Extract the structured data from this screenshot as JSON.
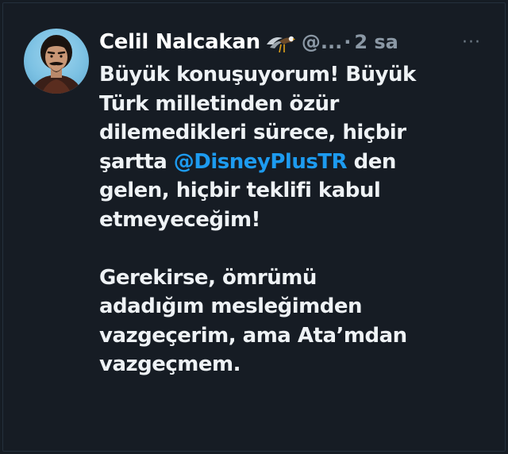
{
  "tweet": {
    "author_name": "Celil Nalcakan",
    "handle": "@...",
    "separator": "·",
    "time": "2 sa",
    "more_label": "···",
    "badge_icon": "eagle-emoji",
    "paragraph1": {
      "line1": "Büyük konuşuyorum! Büyük",
      "line2": "Türk milletinden özür",
      "line3": "dilemedikleri sürece, hiçbir",
      "line4_before": "şartta ",
      "mention": "@DisneyPlusTR",
      "line4_after": " den",
      "line5": "gelen, hiçbir teklifi kabul",
      "line6": "etmeyeceğim!"
    },
    "paragraph2": {
      "line1": "Gerekirse, ömrümü",
      "line2": "adadığım mesleğimden",
      "line3": "vazgeçerim, ama Ata’mdan",
      "line4": "vazgeçmem."
    }
  },
  "colors": {
    "background": "#161c24",
    "text": "#eef2f5",
    "muted": "#8b98a5",
    "mention": "#1d9bf0"
  }
}
